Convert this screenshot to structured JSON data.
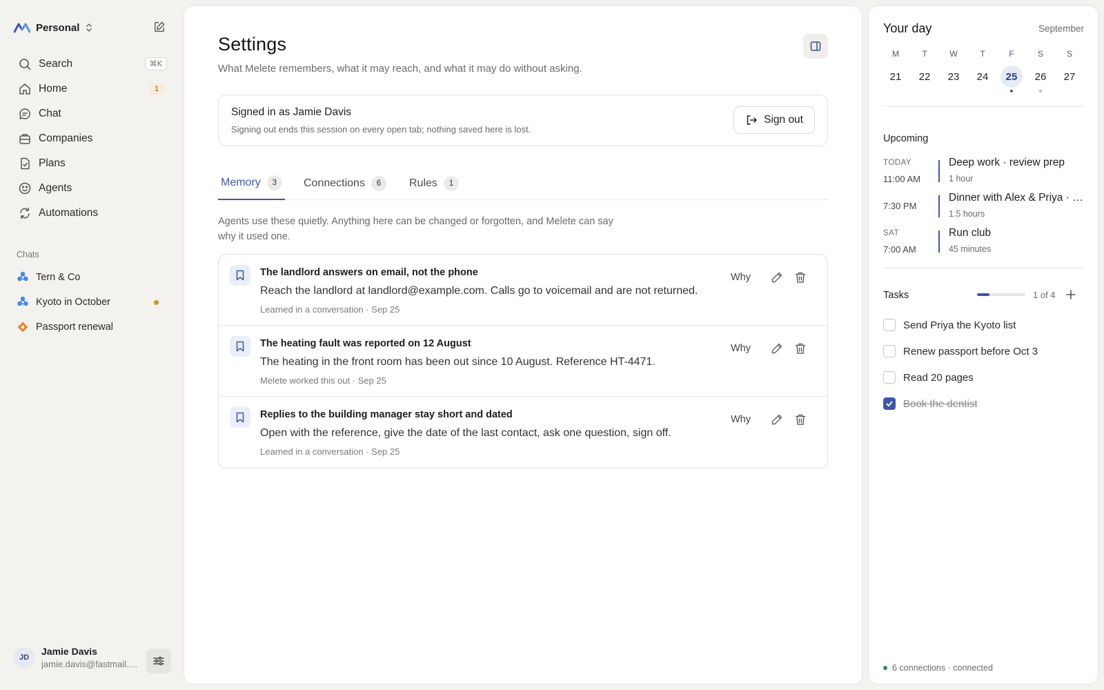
{
  "workspace": {
    "name": "Personal"
  },
  "sidebar": {
    "search": {
      "label": "Search",
      "shortcut": "⌘K"
    },
    "items": [
      {
        "label": "Home",
        "badge": "1"
      },
      {
        "label": "Chat"
      },
      {
        "label": "Companies"
      },
      {
        "label": "Plans"
      },
      {
        "label": "Agents"
      },
      {
        "label": "Automations"
      }
    ],
    "chats_label": "Chats",
    "chats": [
      {
        "label": "Tern & Co",
        "color": "#4a86e8"
      },
      {
        "label": "Kyoto in October",
        "color": "#4a86e8",
        "unread": true
      },
      {
        "label": "Passport renewal",
        "color": "#e8873a"
      }
    ],
    "user": {
      "initials": "JD",
      "name": "Jamie Davis",
      "email": "jamie.davis@fastmail.com"
    }
  },
  "main": {
    "title": "Settings",
    "subtitle": "What Melete remembers, what it may reach, and what it may do without asking.",
    "signin": {
      "title": "Signed in as Jamie Davis",
      "subtitle": "Signing out ends this session on every open tab; nothing saved here is lost.",
      "button": "Sign out"
    },
    "tabs": [
      {
        "label": "Memory",
        "count": "3",
        "active": true
      },
      {
        "label": "Connections",
        "count": "6"
      },
      {
        "label": "Rules",
        "count": "1"
      }
    ],
    "intro": "Agents use these quietly. Anything here can be changed or forgotten, and Melete can say why it used one.",
    "why_label": "Why",
    "memories": [
      {
        "title": "The landlord answers on email, not the phone",
        "body": "Reach the landlord at landlord@example.com. Calls go to voicemail and are not returned.",
        "meta": "Learned in a conversation · Sep 25"
      },
      {
        "title": "The heating fault was reported on 12 August",
        "body": "The heating in the front room has been out since 10 August. Reference HT-4471.",
        "meta": "Melete worked this out · Sep 25"
      },
      {
        "title": "Replies to the building manager stay short and dated",
        "body": "Open with the reference, give the date of the last contact, ask one question, sign off.",
        "meta": "Learned in a conversation · Sep 25"
      }
    ]
  },
  "right": {
    "title": "Your day",
    "month": "September",
    "week": [
      {
        "letter": "M",
        "num": "21"
      },
      {
        "letter": "T",
        "num": "22"
      },
      {
        "letter": "W",
        "num": "23"
      },
      {
        "letter": "T",
        "num": "24"
      },
      {
        "letter": "F",
        "num": "25",
        "today": true,
        "dot": "#3e56a8"
      },
      {
        "letter": "S",
        "num": "26",
        "dot": "#bdbdbd"
      },
      {
        "letter": "S",
        "num": "27"
      }
    ],
    "upcoming_label": "Upcoming",
    "events": [
      {
        "day": "TODAY",
        "time": "11:00 AM",
        "title": "Deep work · review prep",
        "duration": "1 hour"
      },
      {
        "day": "",
        "time": "7:30 PM",
        "title": "Dinner with Alex & Priya · Ramen Bar",
        "duration": "1.5 hours"
      },
      {
        "day": "SAT",
        "time": "7:00 AM",
        "title": "Run club",
        "duration": "45 minutes"
      }
    ],
    "tasks_label": "Tasks",
    "tasks_progress": 0.25,
    "tasks_count": "1 of 4",
    "tasks": [
      {
        "label": "Send Priya the Kyoto list",
        "done": false
      },
      {
        "label": "Renew passport before Oct 3",
        "done": false
      },
      {
        "label": "Read 20 pages",
        "done": false
      },
      {
        "label": "Book the dentist",
        "done": true
      }
    ],
    "status": "6 connections · connected"
  }
}
